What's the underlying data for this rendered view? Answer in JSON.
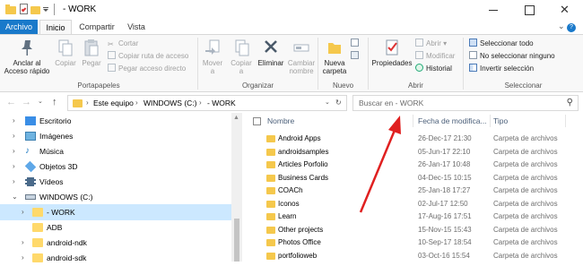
{
  "window": {
    "title": "- WORK"
  },
  "tabs": {
    "file": "Archivo",
    "home": "Inicio",
    "share": "Compartir",
    "view": "Vista"
  },
  "ribbon": {
    "clipboard": {
      "pin": "Anclar al Acceso rápido",
      "copy": "Copiar",
      "paste": "Pegar",
      "cut": "Cortar",
      "copy_path": "Copiar ruta de acceso",
      "paste_shortcut": "Pegar acceso directo",
      "label": "Portapapeles"
    },
    "organize": {
      "move_to": "Mover a",
      "copy_to": "Copiar a",
      "delete": "Eliminar",
      "rename": "Cambiar nombre",
      "label": "Organizar"
    },
    "new": {
      "new_folder": "Nueva carpeta",
      "label": "Nuevo"
    },
    "open": {
      "properties": "Propiedades",
      "open": "Abrir",
      "edit": "Modificar",
      "history": "Historial",
      "label": "Abrir"
    },
    "select": {
      "select_all": "Seleccionar todo",
      "select_none": "No seleccionar ninguno",
      "invert": "Invertir selección",
      "label": "Seleccionar"
    }
  },
  "address": {
    "crumbs": [
      "Este equipo",
      "WINDOWS (C:)",
      "- WORK"
    ]
  },
  "search": {
    "placeholder": "Buscar en - WORK"
  },
  "nav": {
    "items": [
      {
        "label": "Escritorio",
        "icon": "desktop-icon"
      },
      {
        "label": "Imágenes",
        "icon": "pictures-icon"
      },
      {
        "label": "Música",
        "icon": "music-icon"
      },
      {
        "label": "Objetos 3D",
        "icon": "objects3d-icon"
      },
      {
        "label": "Vídeos",
        "icon": "videos-icon"
      },
      {
        "label": "WINDOWS (C:)",
        "icon": "drive-icon"
      },
      {
        "label": "- WORK",
        "icon": "folder-icon"
      },
      {
        "label": "ADB",
        "icon": "folder-icon"
      },
      {
        "label": "android-ndk",
        "icon": "folder-icon"
      },
      {
        "label": "android-sdk",
        "icon": "folder-icon"
      }
    ]
  },
  "columns": {
    "name": "Nombre",
    "date": "Fecha de modifica...",
    "type": "Tipo"
  },
  "files": [
    {
      "name": "Android Apps",
      "date": "26-Dec-17 21:30",
      "type": "Carpeta de archivos"
    },
    {
      "name": "androidsamples",
      "date": "05-Jun-17 22:10",
      "type": "Carpeta de archivos"
    },
    {
      "name": "Articles Porfolio",
      "date": "26-Jan-17 10:48",
      "type": "Carpeta de archivos"
    },
    {
      "name": "Business Cards",
      "date": "04-Dec-15 10:15",
      "type": "Carpeta de archivos"
    },
    {
      "name": "COACh",
      "date": "25-Jan-18 17:27",
      "type": "Carpeta de archivos"
    },
    {
      "name": "Iconos",
      "date": "02-Jul-17 12:50",
      "type": "Carpeta de archivos"
    },
    {
      "name": "Learn",
      "date": "17-Aug-16 17:51",
      "type": "Carpeta de archivos"
    },
    {
      "name": "Other projects",
      "date": "15-Nov-15 15:43",
      "type": "Carpeta de archivos"
    },
    {
      "name": "Photos Office",
      "date": "10-Sep-17 18:54",
      "type": "Carpeta de archivos"
    },
    {
      "name": "portfolioweb",
      "date": "03-Oct-16 15:54",
      "type": "Carpeta de archivos"
    }
  ],
  "colors": {
    "accent": "#1979ca",
    "selection": "#cce8ff",
    "folder": "#f5c84c",
    "arrow": "#e02020"
  }
}
